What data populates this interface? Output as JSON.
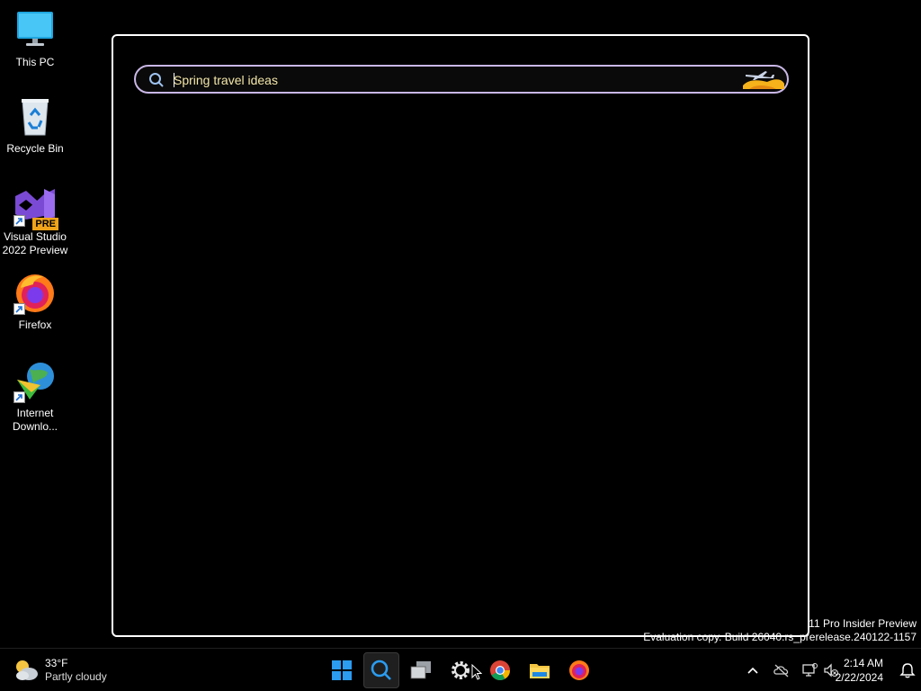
{
  "desktop": {
    "icons": [
      {
        "label": "This PC"
      },
      {
        "label": "Recycle Bin"
      },
      {
        "label": "Visual Studio 2022 Preview",
        "badge": "PRE"
      },
      {
        "label": "Firefox"
      },
      {
        "label": "Internet Downlo..."
      }
    ]
  },
  "search": {
    "query": "Spring travel ideas",
    "accent_color": "#c9b7e6",
    "text_color": "#f3e6a8"
  },
  "watermark": {
    "line1": "11 Pro Insider Preview",
    "line2": "Evaluation copy. Build 26040.rs_prerelease.240122-1157"
  },
  "taskbar": {
    "weather": {
      "temp": "33°F",
      "condition": "Partly cloudy"
    },
    "apps": [
      {
        "name": "start-icon"
      },
      {
        "name": "search-icon",
        "active": true
      },
      {
        "name": "task-view-icon"
      },
      {
        "name": "settings-icon"
      },
      {
        "name": "chrome-icon"
      },
      {
        "name": "file-explorer-icon"
      },
      {
        "name": "firefox-icon"
      }
    ],
    "clock": {
      "time": "2:14 AM",
      "date": "2/22/2024"
    }
  }
}
